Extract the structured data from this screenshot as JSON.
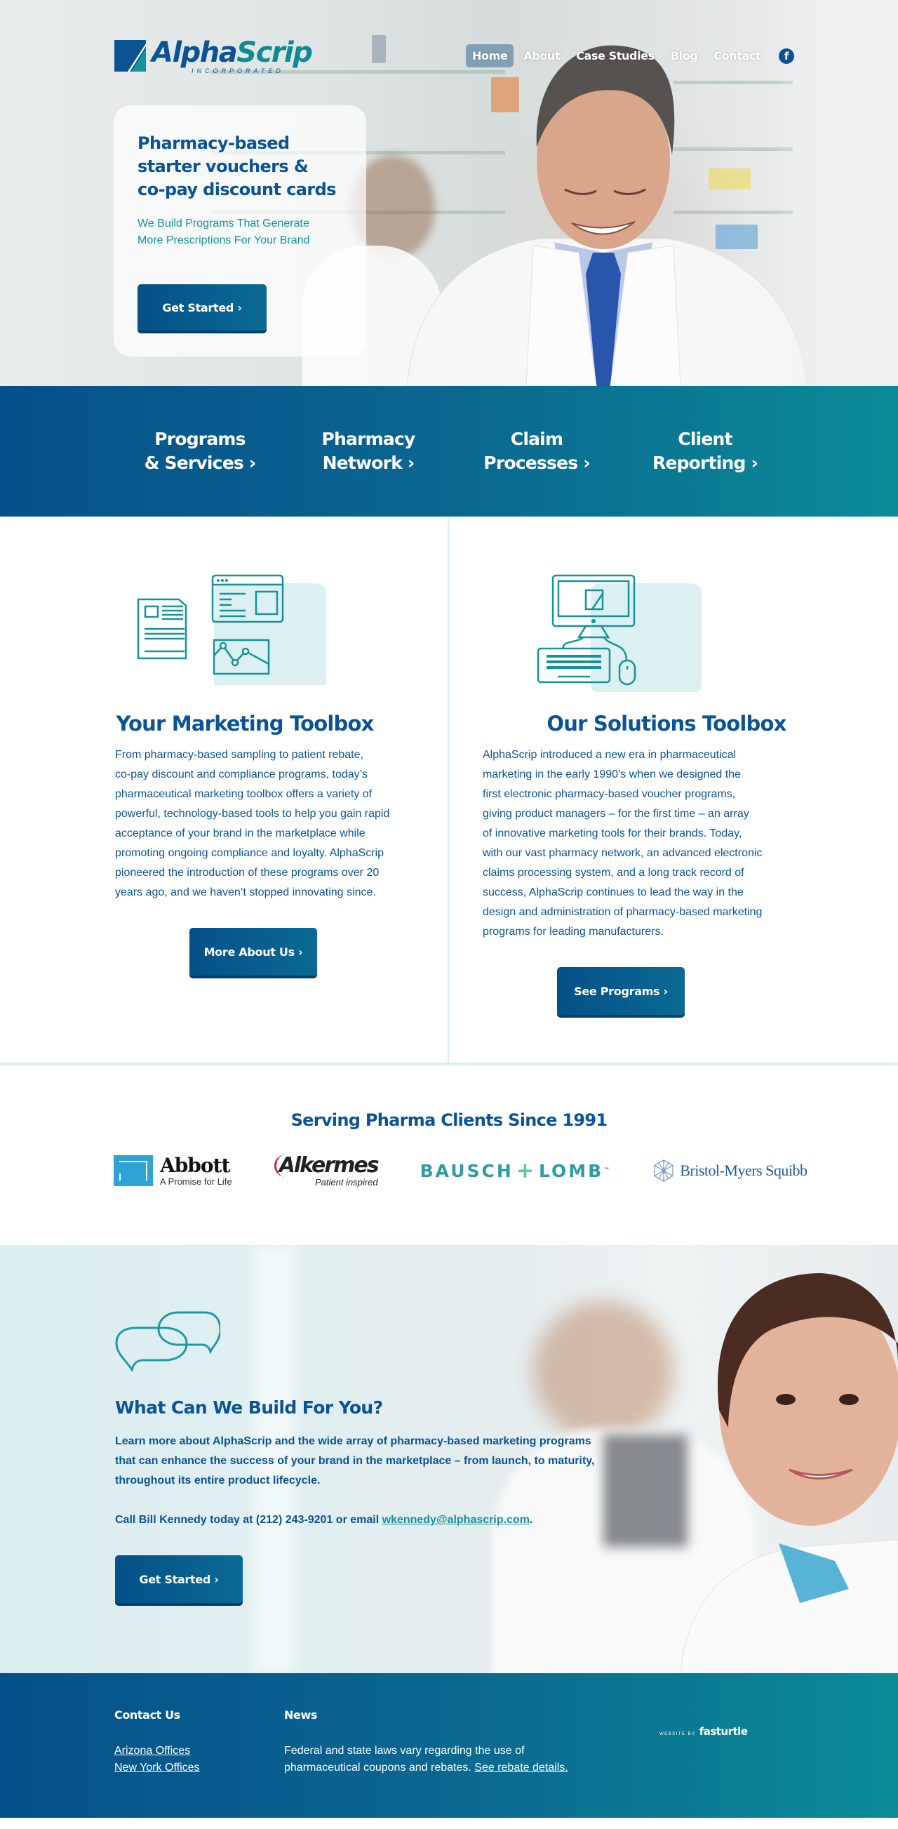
{
  "brand": {
    "name_part1": "Alpha",
    "name_part2": "Scrip",
    "tagline": "INCORPORATED",
    "colors": {
      "primary": "#0b5394",
      "teal": "#0f8a94",
      "light_teal": "#d7eef0"
    }
  },
  "nav": {
    "items": [
      {
        "label": "Home",
        "active": true
      },
      {
        "label": "About",
        "active": false
      },
      {
        "label": "Case Studies",
        "active": false
      },
      {
        "label": "Blog",
        "active": false
      },
      {
        "label": "Contact",
        "active": false
      }
    ],
    "social_icon": "facebook-icon",
    "social_glyph": "f"
  },
  "hero": {
    "title_lines": [
      "Pharmacy-based",
      "starter vouchers &",
      "co-pay discount cards"
    ],
    "subtitle_lines": [
      "We Build Programs That Generate",
      "More Prescriptions For Your Brand"
    ],
    "cta_label": "Get Started ›"
  },
  "categories": [
    {
      "line1": "Programs",
      "line2": "& Services ›"
    },
    {
      "line1": "Pharmacy",
      "line2": "Network ›"
    },
    {
      "line1": "Claim",
      "line2": "Processes ›"
    },
    {
      "line1": "Client",
      "line2": "Reporting ›"
    }
  ],
  "toolbox": {
    "marketing": {
      "icon": "documents-icon",
      "title": "Your Marketing Toolbox",
      "lines": [
        "From pharmacy-based sampling to patient rebate,",
        "co-pay discount and compliance programs, today’s",
        "pharmaceutical marketing toolbox offers a variety of",
        "powerful, technology-based tools to help you gain rapid",
        "acceptance of your brand in the marketplace while",
        "promoting ongoing compliance and loyalty. AlphaScrip",
        "pioneered the introduction of these programs over 20",
        "years ago, and we haven’t stopped innovating since."
      ],
      "button": "More About Us ›"
    },
    "solutions": {
      "icon": "computer-icon",
      "title": "Our Solutions Toolbox",
      "lines": [
        "AlphaScrip introduced a new era in pharmaceutical",
        "marketing in the early 1990’s when we designed the",
        "first electronic pharmacy-based voucher programs,",
        "giving product managers – for the first time – an array",
        "of innovative marketing tools for their brands. Today,",
        "with our vast pharmacy network, an advanced electronic",
        "claims processing system, and a long track record of",
        "success, AlphaScrip continues to lead the way in the",
        "design and administration of pharmacy-based marketing",
        "programs for leading manufacturers."
      ],
      "button": "See Programs ›"
    }
  },
  "clients": {
    "title": "Serving Pharma Clients Since 1991",
    "logos": [
      {
        "name": "Abbott",
        "tagline": "A Promise for Life"
      },
      {
        "name": "Alkermes",
        "tagline": "Patient inspired"
      },
      {
        "name_left": "BAUSCH",
        "name_right": "LOMB",
        "tm": "™"
      },
      {
        "name": "Bristol-Myers Squibb"
      }
    ]
  },
  "cta": {
    "icon": "speech-bubbles-icon",
    "title": "What Can We Build For You?",
    "body_lines": [
      "Learn more about AlphaScrip and the wide array of pharmacy-based marketing programs",
      "that can enhance the success of your brand in the marketplace – from launch, to maturity,",
      "throughout its entire product lifecycle."
    ],
    "call_prefix": "Call Bill Kennedy today at (212) 243-9201 or email ",
    "email": "wkennedy@alphascrip.com",
    "call_suffix": ".",
    "button": "Get Started ›"
  },
  "footer": {
    "contact_heading": "Contact Us",
    "contact_links": [
      "Arizona Offices",
      "New York Offices"
    ],
    "news_heading": "News",
    "news_text_line1": "Federal and state laws vary regarding the use of",
    "news_text_line2": "pharmaceutical coupons and rebates. ",
    "news_link": "See rebate details.",
    "credit_small": "WEBSITE BY",
    "credit_big": "fasturtle"
  }
}
